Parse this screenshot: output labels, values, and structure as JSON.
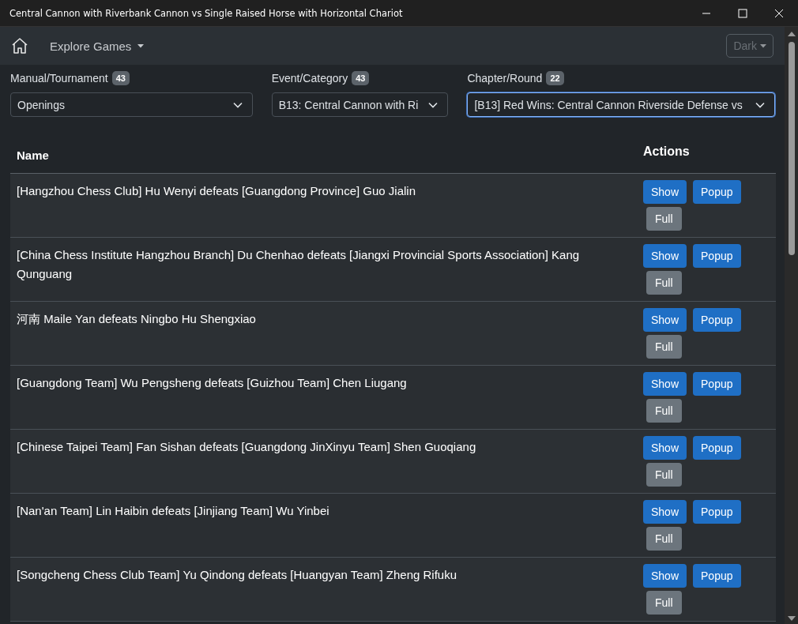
{
  "window": {
    "title": "Central Cannon with Riverbank Cannon vs Single Raised Horse with Horizontal Chariot"
  },
  "navbar": {
    "menu": "Explore Games",
    "theme_button": "Dark",
    "theme_disabled": true
  },
  "filters": [
    {
      "label": "Manual/Tournament",
      "count": "43",
      "value": "Openings",
      "focused": false
    },
    {
      "label": "Event/Category",
      "count": "43",
      "value": "B13: Central Cannon with Ri",
      "focused": false
    },
    {
      "label": "Chapter/Round",
      "count": "22",
      "value": "[B13] Red Wins: Central Cannon Riverside Defense vs",
      "focused": true
    }
  ],
  "table": {
    "columns": [
      "Name",
      "Actions"
    ],
    "rows": [
      {
        "name": "[Hangzhou Chess Club] Hu Wenyi defeats [Guangdong Province] Guo Jialin",
        "actions": [
          "Show",
          "Popup",
          "Full"
        ]
      },
      {
        "name": "[China Chess Institute Hangzhou Branch] Du Chenhao defeats [Jiangxi Provincial Sports Association] Kang Qunguang",
        "actions": [
          "Show",
          "Popup",
          "Full"
        ]
      },
      {
        "name": "河南 Maile Yan defeats Ningbo Hu Shengxiao",
        "actions": [
          "Show",
          "Popup",
          "Full"
        ]
      },
      {
        "name": "[Guangdong Team] Wu Pengsheng defeats [Guizhou Team] Chen Liugang",
        "actions": [
          "Show",
          "Popup",
          "Full"
        ]
      },
      {
        "name": "[Chinese Taipei Team] Fan Sishan defeats [Guangdong JinXinyu Team] Shen Guoqiang",
        "actions": [
          "Show",
          "Popup",
          "Full"
        ]
      },
      {
        "name": "[Nan'an Team] Lin Haibin defeats [Jinjiang Team] Wu Yinbei",
        "actions": [
          "Show",
          "Popup",
          "Full"
        ]
      },
      {
        "name": "[Songcheng Chess Club Team] Yu Qindong defeats [Huangyan Team] Zheng Rifuku",
        "actions": [
          "Show",
          "Popup",
          "Full"
        ]
      }
    ]
  }
}
